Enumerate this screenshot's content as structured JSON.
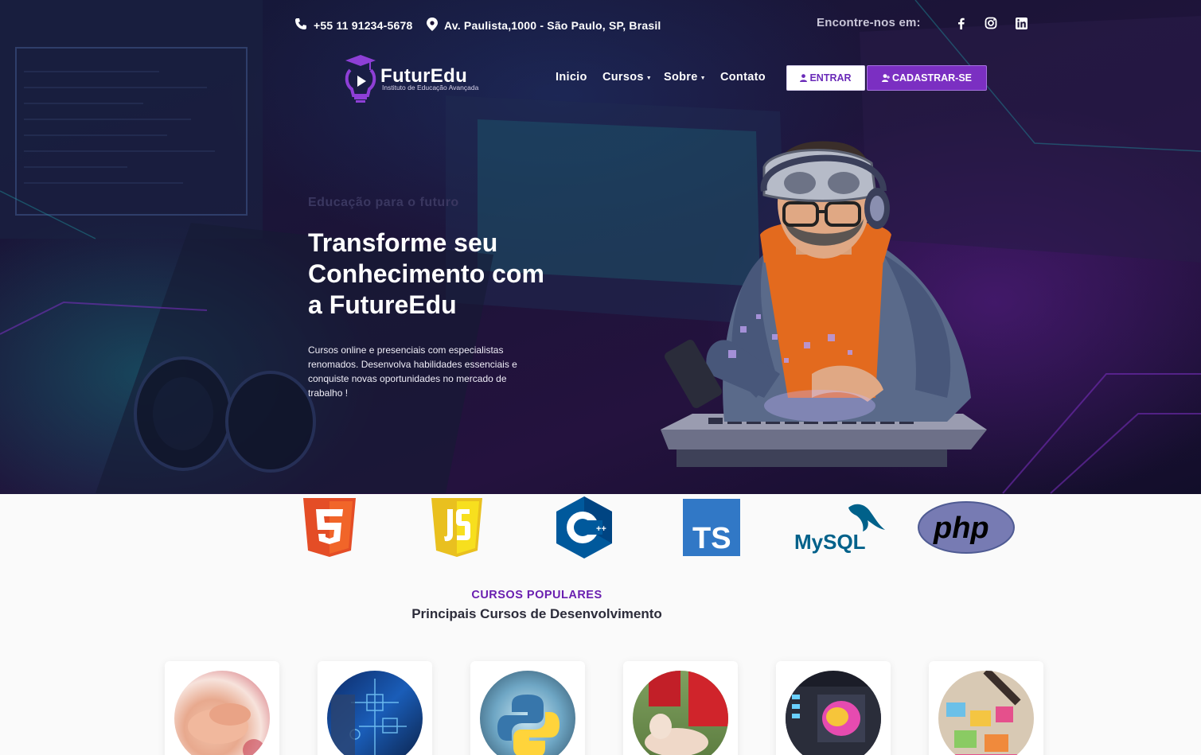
{
  "topbar": {
    "phone": "+55 11 91234-5678",
    "address": "Av. Paulista,1000 - São Paulo, SP, Brasil",
    "follow_label": "Encontre-nos em:"
  },
  "brand": {
    "name": "FuturEdu",
    "tagline": "Instituto de Educação Avançada"
  },
  "nav": {
    "items": [
      {
        "label": "Inicio"
      },
      {
        "label": "Cursos"
      },
      {
        "label": "Sobre"
      },
      {
        "label": "Contato"
      }
    ],
    "login_label": "ENTRAR",
    "signup_label": "CADASTRAR-SE"
  },
  "hero": {
    "eyebrow": "Educação para o futuro",
    "headline": "Transforme seu Conhecimento com a FutureEdu",
    "lead": "Cursos online e presenciais com especialistas renomados. Desenvolva habilidades essenciais e conquiste novas oportunidades no mercado de trabalho !"
  },
  "tech_logos": [
    "html5",
    "javascript",
    "cpp",
    "typescript",
    "mysql",
    "php"
  ],
  "tech_text": {
    "ts": "TS",
    "mysql_main": "MySQL",
    "php": "php",
    "cpp": "++"
  },
  "section": {
    "kicker": "CURSOS POPULARES",
    "title": "Principais Cursos de Desenvolvimento"
  },
  "courses": [
    {
      "image": "massage-hands"
    },
    {
      "image": "engineering-circuit"
    },
    {
      "image": "python-logo"
    },
    {
      "image": "first-aid-cpr"
    },
    {
      "image": "graphic-design-screen"
    },
    {
      "image": "design-board"
    }
  ],
  "colors": {
    "accent": "#7b2fc2",
    "kicker": "#6a1fb0",
    "hero_bg": "#1c1438"
  }
}
